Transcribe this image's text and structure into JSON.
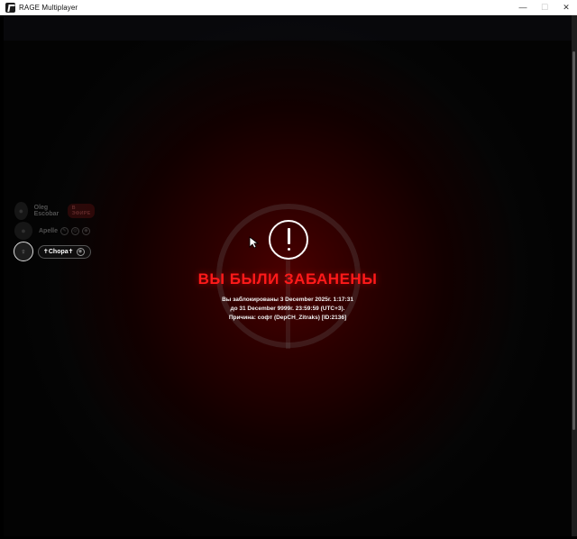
{
  "window": {
    "title": "RAGE Multiplayer",
    "controls": {
      "minimize": "—",
      "maximize": "☐",
      "close": "✕"
    }
  },
  "ban": {
    "title": "ВЫ БЫЛИ ЗАБАНЕНЫ",
    "line1": "Вы заблокированы 3 December 2025г. 1:17:31",
    "line2": "до 31 December 9999г. 23:59:59 (UTC+3).",
    "line3": "Причина: софт (DepCH_Zitraks) [ID:2136]"
  },
  "players": [
    {
      "name": "Oleg Escobar",
      "badge": "В ЭФИРЕ"
    },
    {
      "name": "Apelle"
    },
    {
      "name": "✝Chopa✝"
    }
  ],
  "colors": {
    "accent": "#ff1a1a",
    "badge_bg": "#6e1313",
    "badge_text": "#ff6b6b"
  },
  "icons": {
    "app": "rage-logo-icon",
    "alert": "exclamation-circle-icon",
    "cursor": "mouse-pointer-icon"
  }
}
